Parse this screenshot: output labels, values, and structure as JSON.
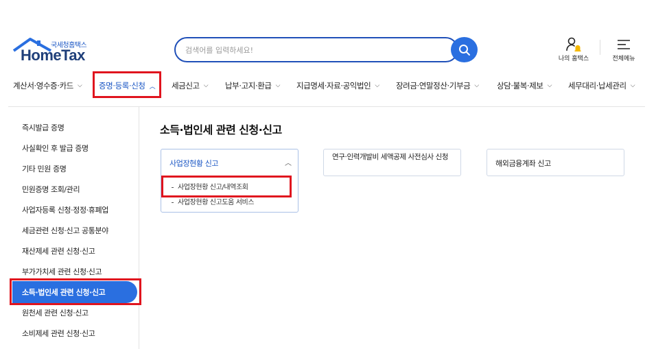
{
  "logo": {
    "sub": "국세청홈택스",
    "main": "HomeTax"
  },
  "search": {
    "placeholder": "검색어를 입력하세요!"
  },
  "util": {
    "my_hometax": "나의 홈택스",
    "all_menu": "전체메뉴"
  },
  "gnb": [
    {
      "label": "계산서·영수증·카드",
      "chevron": "⌵"
    },
    {
      "label": "증명·등록·신청",
      "chevron": "︿",
      "active": true
    },
    {
      "label": "세금신고",
      "chevron": "⌵"
    },
    {
      "label": "납부·고지·환급",
      "chevron": "⌵"
    },
    {
      "label": "지급명세·자료·공익법인",
      "chevron": "⌵"
    },
    {
      "label": "장려금·연말정산·기부금",
      "chevron": "⌵"
    },
    {
      "label": "상담·불복·제보",
      "chevron": "⌵"
    },
    {
      "label": "세무대리·납세관리",
      "chevron": "⌵"
    }
  ],
  "sidebar": [
    "즉시발급 증명",
    "사실확인 후 발급 증명",
    "기타 민원 증명",
    "민원증명 조회/관리",
    "사업자등록 신청·정정·휴폐업",
    "세금관련 신청·신고 공통분야",
    "재산제세 관련 신청·신고",
    "부가가치세 관련 신청·신고",
    "소득·법인세 관련 신청·신고",
    "원천세 관련 신청·신고",
    "소비제세 관련 신청·신고"
  ],
  "sidebar_active_index": 8,
  "page_title": "소득·법인세 관련 신청·신고",
  "cards": [
    {
      "title": "사업장현황 신고",
      "chevron": "︿",
      "items": [
        "사업장현황 신고/내역조회",
        "사업장현황 신고도움 서비스"
      ]
    },
    {
      "title": "연구·인력개발비 세액공제 사전심사 신청"
    },
    {
      "title": "해외금융계좌 신고"
    }
  ],
  "colors": {
    "primary": "#2a6fe0",
    "link": "#1a56c4",
    "highlight": "#e0141e"
  }
}
